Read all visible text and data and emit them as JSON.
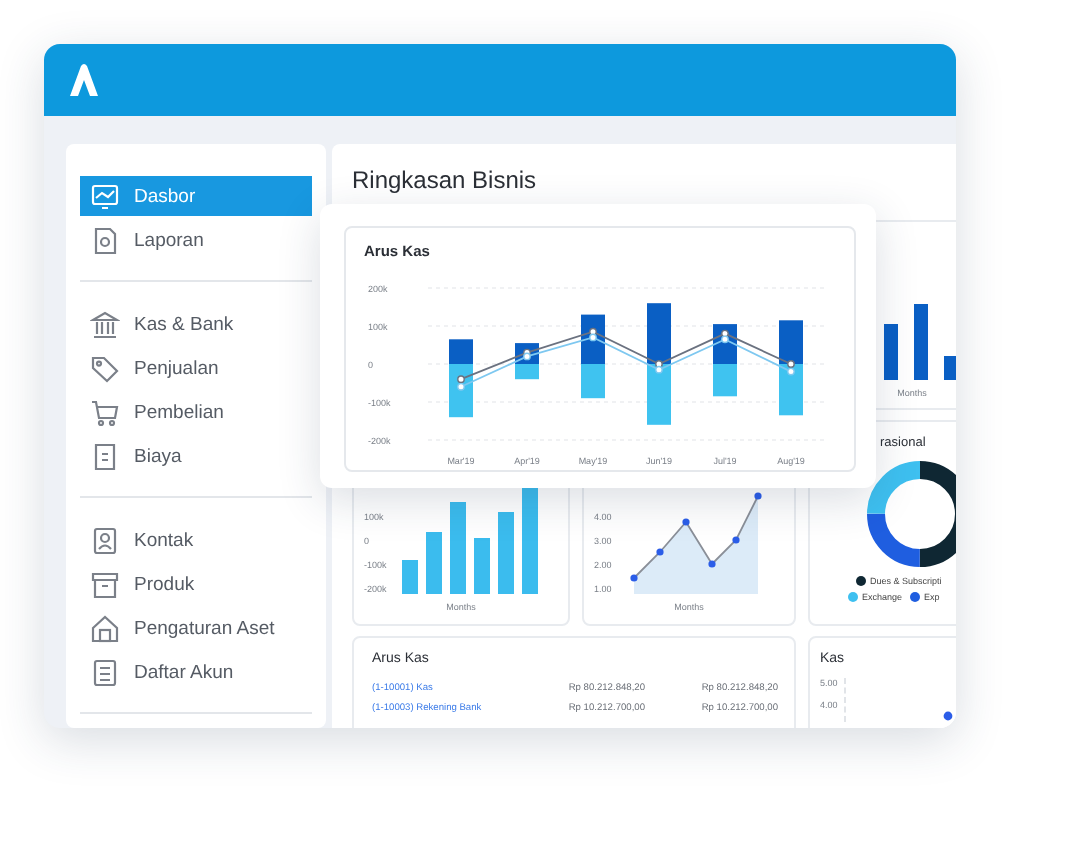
{
  "sidebar": {
    "groups": [
      {
        "items": [
          {
            "label": "Dasbor",
            "selected": true
          },
          {
            "label": "Laporan",
            "selected": false
          }
        ]
      },
      {
        "items": [
          {
            "label": "Kas & Bank",
            "selected": false
          },
          {
            "label": "Penjualan",
            "selected": false
          },
          {
            "label": "Pembelian",
            "selected": false
          },
          {
            "label": "Biaya",
            "selected": false
          }
        ]
      },
      {
        "items": [
          {
            "label": "Kontak",
            "selected": false
          },
          {
            "label": "Produk",
            "selected": false
          },
          {
            "label": "Pengaturan Aset",
            "selected": false
          },
          {
            "label": "Daftar Akun",
            "selected": false
          }
        ]
      }
    ]
  },
  "main": {
    "title": "Ringkasan Bisnis",
    "cash_flow_popup": {
      "title": "Arus Kas",
      "chart_data": {
        "type": "bar",
        "stacked": true,
        "grid": true,
        "categories": [
          "Mar'19",
          "Apr'19",
          "May'19",
          "Jun'19",
          "Jul'19",
          "Aug'19"
        ],
        "ylim": [
          -200,
          200
        ],
        "yticks": [
          {
            "value": 200,
            "label": "200k"
          },
          {
            "value": 100,
            "label": "100k"
          },
          {
            "value": 0,
            "label": "0"
          },
          {
            "value": -100,
            "label": "-100k"
          },
          {
            "value": -200,
            "label": "-200k"
          }
        ],
        "series": [
          {
            "color": "#0a5fc4",
            "values": [
              65,
              55,
              130,
              160,
              105,
              115
            ]
          },
          {
            "color": "#3fc3f0",
            "values": [
              -140,
              -40,
              -90,
              -160,
              -85,
              -135
            ]
          },
          {
            "type": "line",
            "marker": true,
            "color": "#6b7280",
            "values": [
              -40,
              30,
              85,
              0,
              80,
              0
            ]
          },
          {
            "type": "line",
            "marker": true,
            "color": "#7ec8f0",
            "values": [
              -60,
              20,
              70,
              -15,
              65,
              -20
            ]
          }
        ]
      }
    },
    "months_card": {
      "xlabel": "Months"
    },
    "bar_card": {
      "axis_labels": [
        "100k",
        "0",
        "-100k",
        "-200k"
      ],
      "xlabel": "Months"
    },
    "line_card": {
      "axis_labels": [
        "4.00",
        "3.00",
        "2.00",
        "1.00"
      ],
      "xlabel": "Months"
    },
    "donut_card": {
      "title": "rasional",
      "legend": [
        {
          "label": "Dues & Subscripti",
          "color": "#0f2733"
        },
        {
          "label": "Exchange",
          "color": "#3ec0f0"
        },
        {
          "label": "Exp",
          "color": "#1f5ee0"
        }
      ]
    },
    "cash_table": {
      "title": "Arus Kas",
      "rows": [
        {
          "account": "(1-10001) Kas",
          "column_2": "Rp 80.212.848,20",
          "column_3": "Rp 80.212.848,20"
        },
        {
          "account": "(1-10003) Rekening Bank",
          "column_2": "Rp 10.212.700,00",
          "column_3": "Rp 10.212.700,00"
        }
      ]
    },
    "kas_card": {
      "title": "Kas",
      "axis_labels": [
        "5.00",
        "4.00"
      ]
    }
  }
}
